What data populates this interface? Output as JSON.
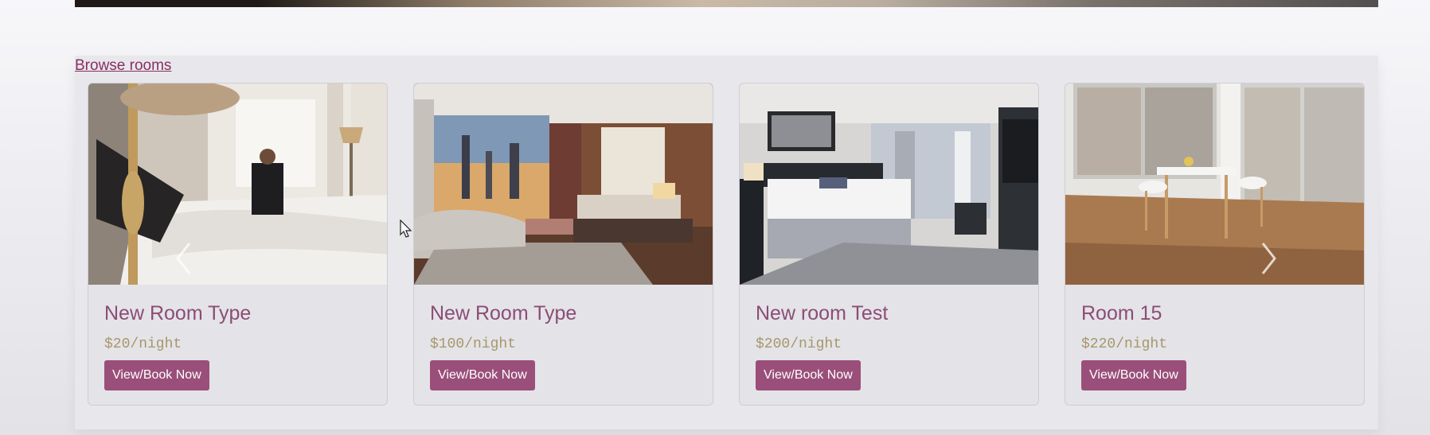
{
  "browse_link": "Browse rooms",
  "rooms": [
    {
      "title": "New Room Type",
      "price": "$20/night",
      "button": "View/Book Now",
      "image": "housekeeper-making-bed-photo"
    },
    {
      "title": "New Room Type",
      "price": "$100/night",
      "button": "View/Book Now",
      "image": "city-view-bedroom-photo"
    },
    {
      "title": "New room Test",
      "price": "$200/night",
      "button": "View/Book Now",
      "image": "hotel-room-with-desk-photo"
    },
    {
      "title": "Room 15",
      "price": "$220/night",
      "button": "View/Book Now",
      "image": "dining-area-city-window-photo"
    }
  ],
  "icons": {
    "prev": "chevron-left-icon",
    "next": "chevron-right-icon",
    "cursor": "mouse-pointer-icon"
  },
  "colors": {
    "accent": "#9a4f7a",
    "title": "#8b4d75",
    "price": "#a6976a",
    "link": "#8a2e62"
  }
}
